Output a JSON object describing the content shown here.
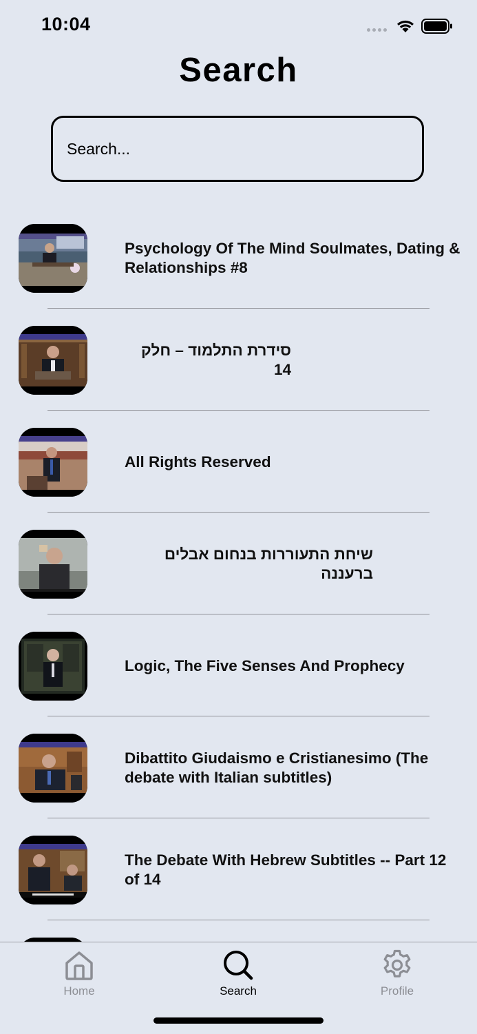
{
  "status_bar": {
    "time": "10:04"
  },
  "header": {
    "title": "Search"
  },
  "search": {
    "placeholder": "Search..."
  },
  "results": [
    {
      "title": "Psychology Of The Mind   Soulmates, Dating & Relationships #8",
      "dir": "ltr"
    },
    {
      "title": "סידרת התלמוד – חלק 14",
      "dir": "rtl"
    },
    {
      "title": "All Rights Reserved",
      "dir": "ltr"
    },
    {
      "title": "שיחת התעוררות בנחום אבלים ברעננה",
      "dir": "rtl"
    },
    {
      "title": "Logic, The Five Senses And Prophecy",
      "dir": "ltr"
    },
    {
      "title": "Dibattito Giudaismo e Cristianesimo (The debate with Italian subtitles)",
      "dir": "ltr"
    },
    {
      "title": "The Debate With Hebrew Subtitles -- Part 12 of 14",
      "dir": "ltr"
    },
    {
      "title": "",
      "dir": "ltr"
    }
  ],
  "tab_bar": {
    "tabs": [
      {
        "label": "Home",
        "icon": "home-icon",
        "active": false
      },
      {
        "label": "Search",
        "icon": "search-icon",
        "active": true
      },
      {
        "label": "Profile",
        "icon": "gear-icon",
        "active": false
      }
    ]
  },
  "colors": {
    "background": "#e2e7f0",
    "inactive_tab": "#8c8e94",
    "active_tab": "#000000",
    "divider": "#8e9096"
  }
}
